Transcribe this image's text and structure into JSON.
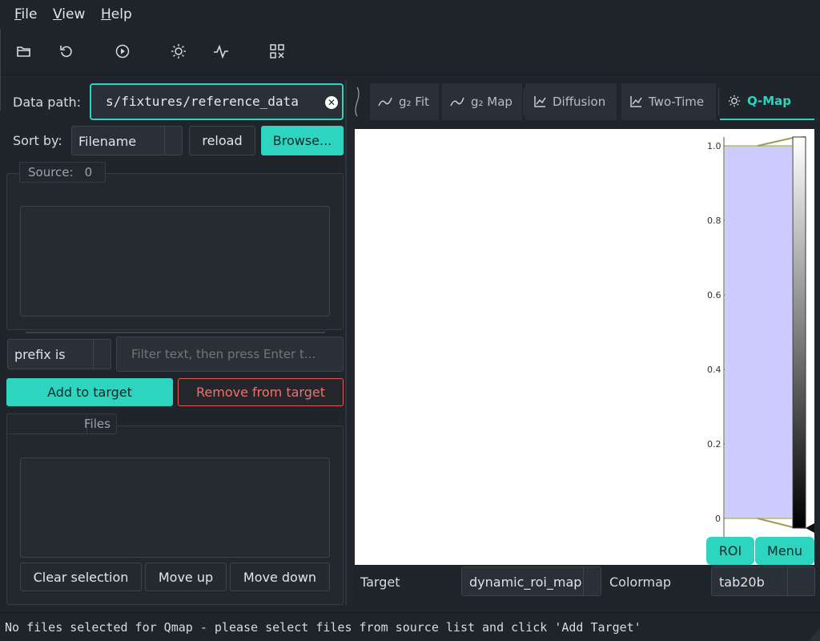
{
  "menu": {
    "file": {
      "underline": "F",
      "rest": "ile"
    },
    "view": {
      "underline": "V",
      "rest": "iew"
    },
    "help": {
      "underline": "H",
      "rest": "elp"
    }
  },
  "toolbar": {
    "icons": [
      "folder-open-icon",
      "refresh-icon",
      "play-icon",
      "sun-icon",
      "pulse-icon",
      "qr-grid-icon"
    ]
  },
  "left": {
    "data_path_label": "Data path:",
    "data_path_value": "s/fixtures/reference_data",
    "sort_by_label": "Sort by:",
    "sort_by_value": "Filename",
    "reload_label": "reload",
    "browse_label": "Browse...",
    "source_label": "Source:",
    "source_count": "0",
    "filter_mode": "prefix is",
    "filter_placeholder": "Filter text, then press Enter t...",
    "add_label": "Add to target",
    "remove_label": "Remove from target",
    "target_files_label": "Files",
    "clear_label": "Clear selection",
    "move_up_label": "Move up",
    "move_down_label": "Move down"
  },
  "tabs": [
    {
      "label": "g₂ Fit",
      "icon": "line-chart-icon"
    },
    {
      "label": "g₂ Map",
      "icon": "line-chart-icon"
    },
    {
      "label": "Diffusion",
      "icon": "axes-chart-icon"
    },
    {
      "label": "Two-Time",
      "icon": "axes-chart-icon"
    },
    {
      "label": "Q-Map",
      "icon": "sun-icon",
      "active": true
    }
  ],
  "plot": {
    "ticks": [
      "1.0",
      "0.8",
      "0.6",
      "0.4",
      "0.2",
      "0"
    ],
    "roi_label": "ROI",
    "menu_label": "Menu",
    "roi_color": "#ccccff"
  },
  "bottom": {
    "target_label": "Target",
    "target_value": "dynamic_roi_map",
    "colormap_label": "Colormap",
    "colormap_value": "tab20b"
  },
  "status": "No files selected for Qmap - please select files from source list and click 'Add Target'",
  "colors": {
    "accent": "#2dd4bf",
    "danger": "#e05a5a",
    "background": "#20252b"
  }
}
